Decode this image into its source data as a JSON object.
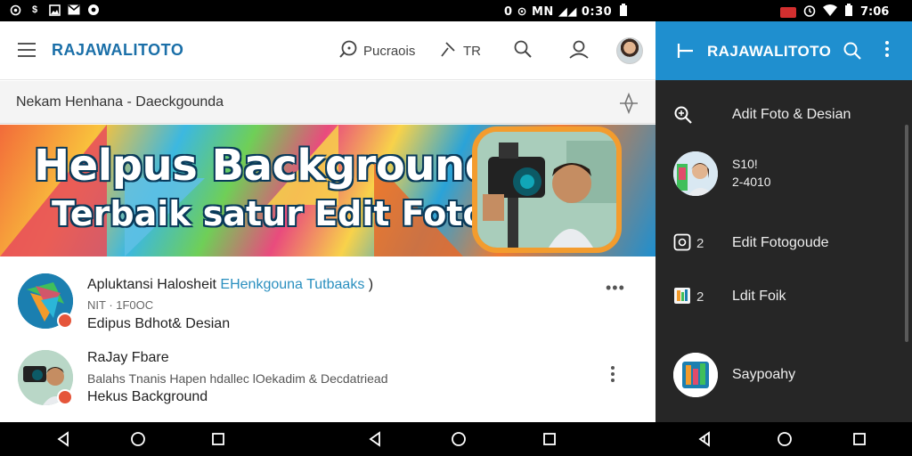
{
  "status_bar": {
    "left_icons": [
      "circle-icon",
      "dollar-icon",
      "image-icon",
      "mail-icon",
      "record-icon"
    ],
    "mid_text": "0 ⊙ MN ◢◢ 0:30",
    "right_time": "7:06"
  },
  "topbar": {
    "brand": "RAJAWALITOTO",
    "item1_label": "Pucraois",
    "item2_label": "TR"
  },
  "subbar": {
    "text": "Nekam Henhana - Daeckgounda"
  },
  "banner": {
    "line1": "Helpus Background",
    "line2": "Terbaik satur Edit Foto"
  },
  "list": [
    {
      "line1_main": "Apluktansi Halosheit ",
      "line1_accent": "EHenkgouna Tutbaaks",
      "line1_tail": " )",
      "line2": "NIT · 1F0OC",
      "line3": "Edipus Bdhot& Desian"
    },
    {
      "line1_main": "RaJay Fbare",
      "line1_accent": "",
      "line1_tail": "",
      "line2": "Balahs Tnanis Hapen hdallec lOekadim & Decdatriead",
      "line3": "Hekus Background"
    }
  ],
  "drawer": {
    "brand": "RAJAWALITOTO",
    "rows": [
      {
        "label": "Adit Foto & Desian",
        "num": ""
      },
      {
        "label": "S10! 2-4010",
        "line1": "S10!",
        "line2": "2-4010",
        "num": ""
      },
      {
        "label": "Edit Fotogoude",
        "num": "2"
      },
      {
        "label": "Ldit Foik",
        "num": "2"
      },
      {
        "label": "Saypoahy",
        "num": ""
      }
    ]
  },
  "colors": {
    "accent_blue": "#1f8fcf",
    "brand_text": "#1a6fa8",
    "drawer_bg": "#262626",
    "badge_red": "#e5553a"
  }
}
